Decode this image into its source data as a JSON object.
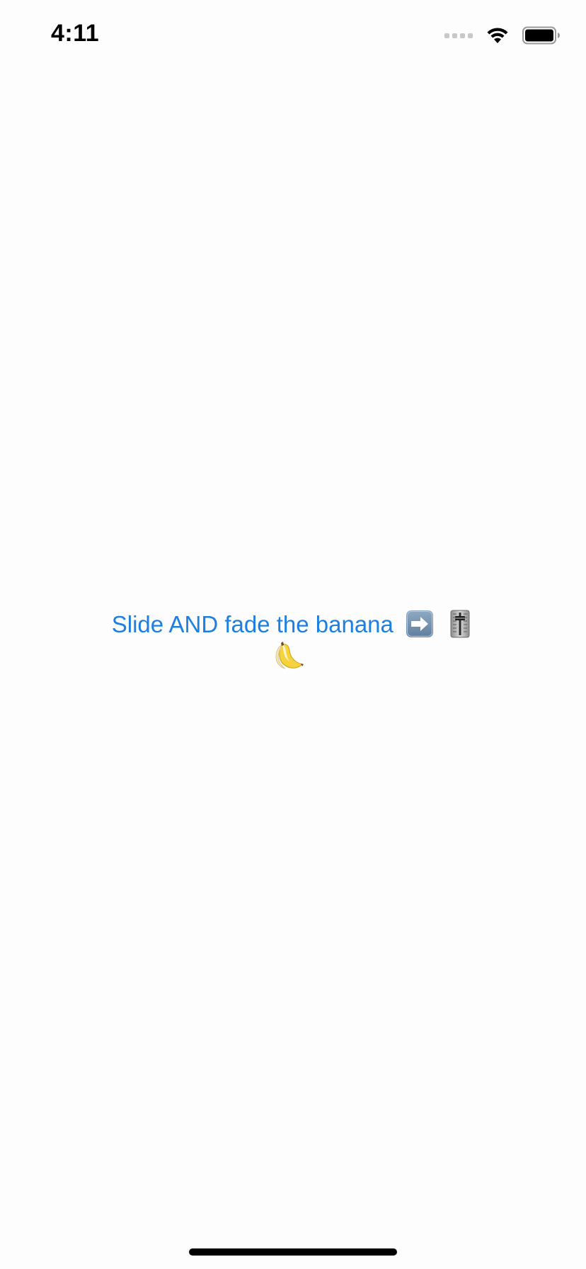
{
  "status_bar": {
    "time": "4:11",
    "icons": [
      "signal-icon",
      "wifi-icon",
      "battery-icon"
    ]
  },
  "main": {
    "button": {
      "label": "Slide AND fade the banana",
      "icons": [
        "right-arrow-icon",
        "level-slider-icon",
        "banana-icon"
      ],
      "color": "#1d7fe0"
    }
  }
}
